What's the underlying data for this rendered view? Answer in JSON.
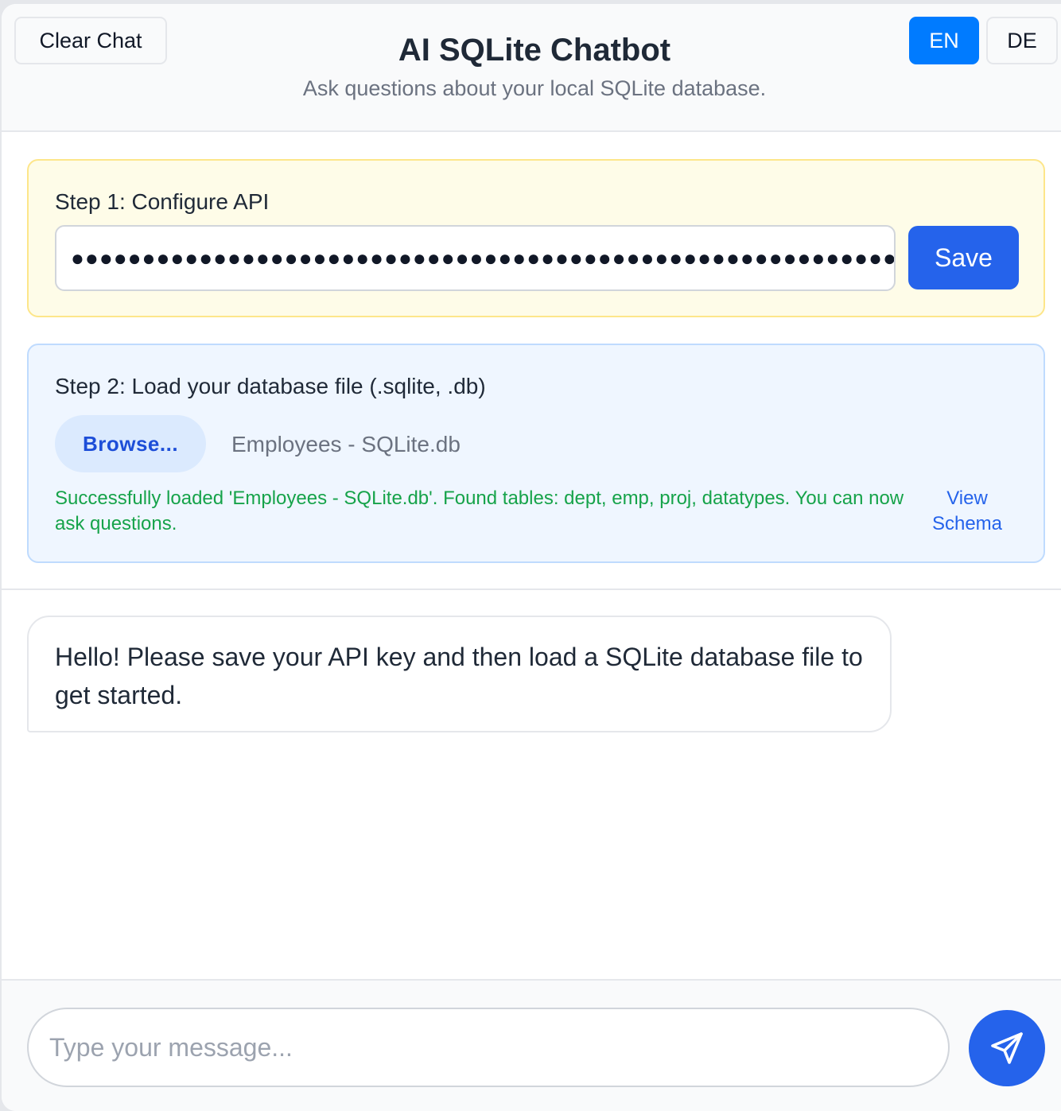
{
  "header": {
    "clear_chat_label": "Clear Chat",
    "title": "AI SQLite Chatbot",
    "subtitle": "Ask questions about your local SQLite database.",
    "languages": [
      {
        "label": "EN",
        "active": true
      },
      {
        "label": "DE",
        "active": false
      }
    ]
  },
  "step1": {
    "label": "Step 1: Configure API",
    "api_key_masked": "●●●●●●●●●●●●●●●●●●●●●●●●●●●●●●●●●●●●●●●●●●●●●●●●●●●●●●●●●●●●●●●●●●●",
    "save_label": "Save"
  },
  "step2": {
    "label": "Step 2: Load your database file (.sqlite, .db)",
    "browse_label": "Browse...",
    "file_name": "Employees - SQLite.db",
    "status_message": "Successfully loaded 'Employees - SQLite.db'. Found tables: dept, emp, proj, datatypes. You can now ask questions.",
    "view_schema_label": "View Schema"
  },
  "chat": {
    "messages": [
      {
        "role": "bot",
        "text": "Hello! Please save your API key and then load a SQLite database file to get started."
      }
    ]
  },
  "composer": {
    "placeholder": "Type your message...",
    "send_icon": "send-icon"
  },
  "colors": {
    "accent": "#2563eb",
    "lang_active": "#007bff",
    "success": "#16a34a",
    "step1_bg": "#fefce8",
    "step2_bg": "#eff6ff"
  }
}
